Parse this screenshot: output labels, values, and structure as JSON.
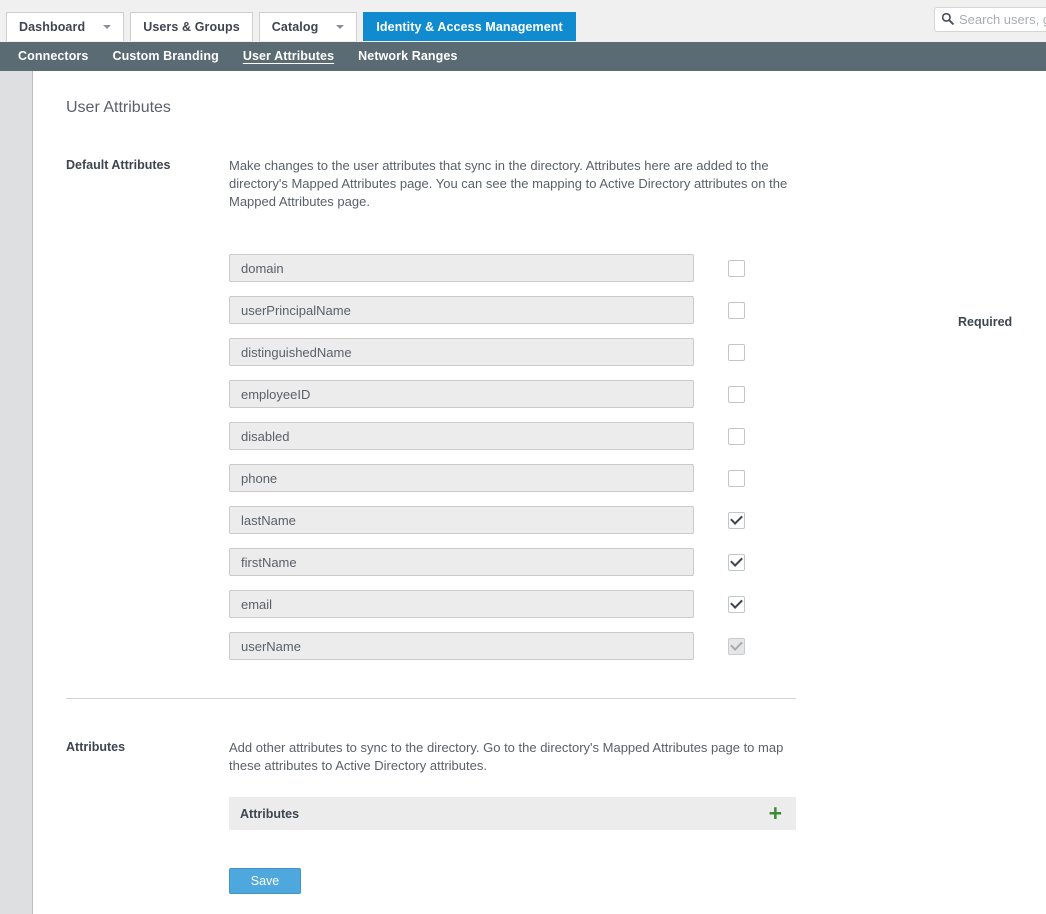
{
  "header": {
    "tabs": [
      {
        "label": "Dashboard",
        "has_caret": true,
        "active": false
      },
      {
        "label": "Users & Groups",
        "has_caret": false,
        "active": false
      },
      {
        "label": "Catalog",
        "has_caret": true,
        "active": false
      },
      {
        "label": "Identity & Access Management",
        "has_caret": false,
        "active": true
      }
    ],
    "search": {
      "placeholder": "Search users, groups or applications",
      "value": "",
      "icon": "search-icon"
    }
  },
  "subnav": {
    "items": [
      {
        "label": "Connectors",
        "active": false
      },
      {
        "label": "Custom Branding",
        "active": false
      },
      {
        "label": "User Attributes",
        "active": true
      },
      {
        "label": "Network Ranges",
        "active": false
      }
    ]
  },
  "page": {
    "title": "User Attributes"
  },
  "default_attributes": {
    "label": "Default Attributes",
    "description": "Make changes to the user attributes that sync in the directory. Attributes here are added to the directory's Mapped Attributes page.  You can see the mapping to Active Directory attributes on the Mapped Attributes page.",
    "required_header": "Required",
    "rows": [
      {
        "value": "domain",
        "required": false,
        "disabled": false
      },
      {
        "value": "userPrincipalName",
        "required": false,
        "disabled": false
      },
      {
        "value": "distinguishedName",
        "required": false,
        "disabled": false
      },
      {
        "value": "employeeID",
        "required": false,
        "disabled": false
      },
      {
        "value": "disabled",
        "required": false,
        "disabled": false
      },
      {
        "value": "phone",
        "required": false,
        "disabled": false
      },
      {
        "value": "lastName",
        "required": true,
        "disabled": false
      },
      {
        "value": "firstName",
        "required": true,
        "disabled": false
      },
      {
        "value": "email",
        "required": true,
        "disabled": false
      },
      {
        "value": "userName",
        "required": true,
        "disabled": true
      }
    ]
  },
  "attributes": {
    "label": "Attributes",
    "description": "Add other attributes to sync to the directory. Go to the directory's Mapped Attributes page to map these attributes to Active Directory attributes.",
    "panel_label": "Attributes",
    "add_icon": "plus-icon"
  },
  "footer": {
    "save_label": "Save"
  },
  "colors": {
    "accent_blue": "#118bd0",
    "subnav_bg": "#5b6b73",
    "add_green": "#3d8b37",
    "save_blue": "#4fa8dd"
  }
}
